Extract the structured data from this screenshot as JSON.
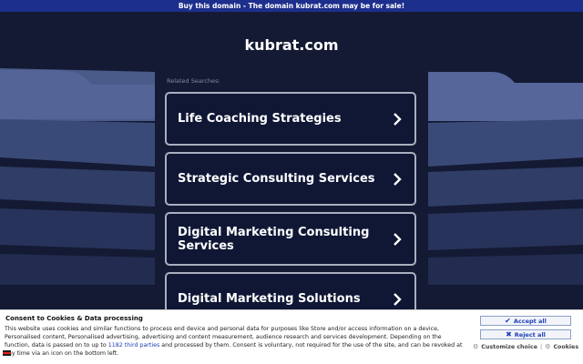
{
  "topbar": {
    "text": "Buy this domain - The domain kubrat.com may be for sale!"
  },
  "header": {
    "domain": "kubrat.com"
  },
  "related": {
    "label": "Related Searches:",
    "items": [
      {
        "label": "Life Coaching Strategies"
      },
      {
        "label": "Strategic Consulting Services"
      },
      {
        "label": "Digital Marketing Consulting Services"
      },
      {
        "label": "Digital Marketing Solutions"
      }
    ]
  },
  "consent": {
    "title": "Consent to Cookies & Data processing",
    "text_1": "This website uses cookies and similar functions to process end device and personal data for purposes like Store and/or access information on a device, Personalised content, Personalised advertising, advertising and content measurement, audience research and services development. Depending on the function, data is passed on to up to",
    "partners_link": "1182 third parties",
    "text_2": "and processed by them. Consent is voluntary, not required for the use of the site, and can be revoked at any time via an icon on the bottom left.",
    "accept_label": "Accept all",
    "reject_label": "Reject all",
    "customize_label": "Customize choice",
    "separator": "|",
    "cookies_label": "Cookies"
  },
  "colors": {
    "topbar_bg": "#1d2f8c",
    "page_bg": "#141a33",
    "card_bg": "#0f1735",
    "card_border": "#a9afbf",
    "button_text": "#1d3fb8"
  },
  "icons": {
    "chevron": "chevron-right-icon",
    "accept": "check-icon",
    "reject": "x-icon",
    "customize": "gear-icon",
    "cookies": "gear-icon",
    "privacy": "flag-icon"
  }
}
